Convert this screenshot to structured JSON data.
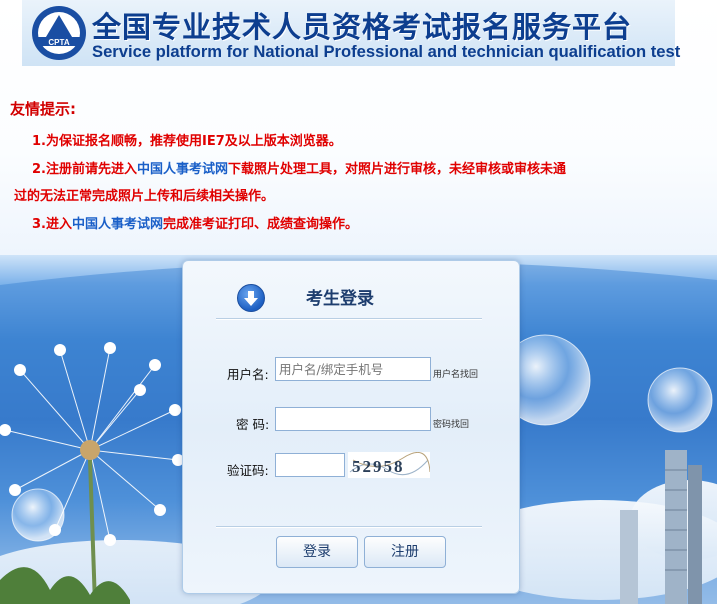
{
  "header": {
    "title_cn": "全国专业技术人员资格考试报名服务平台",
    "title_en": "Service platform for National Professional and technician qualification test"
  },
  "notice": {
    "title": "友情提示:",
    "line1": "1.为保证报名顺畅，推荐使用IE7及以上版本浏览器。",
    "line2_a": "2.注册前请先进入",
    "line2_link": "中国人事考试网",
    "line2_b": "下载照片处理工具，对照片进行审核，未经审核或审核未通",
    "line2_c": "过的无法正常完成照片上传和后续相关操作。",
    "line3_a": "3.进入",
    "line3_link": "中国人事考试网",
    "line3_b": "完成准考证打印、成绩查询操作。"
  },
  "login": {
    "title": "考生登录",
    "username_label": "用户名:",
    "username_placeholder": "用户名/绑定手机号",
    "username_recover": "用户名找回",
    "password_label": "密 码:",
    "password_recover": "密码找回",
    "captcha_label": "验证码:",
    "captcha_text": "52958",
    "login_button": "登录",
    "register_button": "注册"
  },
  "colors": {
    "notice_red": "#e00000",
    "link_blue": "#1a5fc8",
    "title_blue": "#0d3e8f"
  }
}
